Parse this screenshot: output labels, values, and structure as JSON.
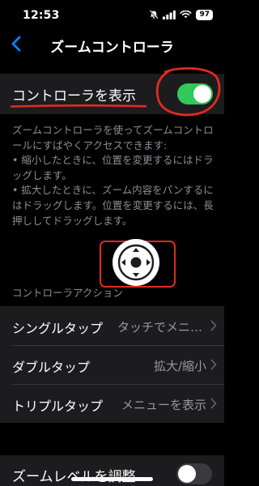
{
  "status_bar": {
    "time": "12:53",
    "battery": "97",
    "icons": [
      "bell-slash-icon",
      "signal-icon",
      "wifi-icon",
      "battery-icon"
    ]
  },
  "nav": {
    "title": "ズームコントローラ",
    "back_icon": "chevron-left-icon"
  },
  "show_controller": {
    "label": "コントローラを表示",
    "on": true
  },
  "description": "ズームコントローラを使ってズームコントロールにすばやくアクセスできます:\n• 縮小したときに、位置を変更するにはドラッグします。\n• 拡大したときに、ズーム内容をパンするにはドラッグします。位置を変更するには、長押ししてドラッグします。",
  "section": {
    "header": "コントローラアクション"
  },
  "actions": [
    {
      "label": "シングルタップ",
      "value": "タッチでメニュー"
    },
    {
      "label": "ダブルタップ",
      "value": "拡大/縮小"
    },
    {
      "label": "トリプルタップ",
      "value": "メニューを表示"
    }
  ],
  "zoom_level": {
    "label": "ズームレベルを調整",
    "on": false
  },
  "colors": {
    "background": "#000000",
    "card": "#1c1c1e",
    "accent_blue": "#0a84ff",
    "switch_green": "#34c759",
    "secondary_text": "#8e8e93",
    "annotation_red": "#e02b20"
  }
}
